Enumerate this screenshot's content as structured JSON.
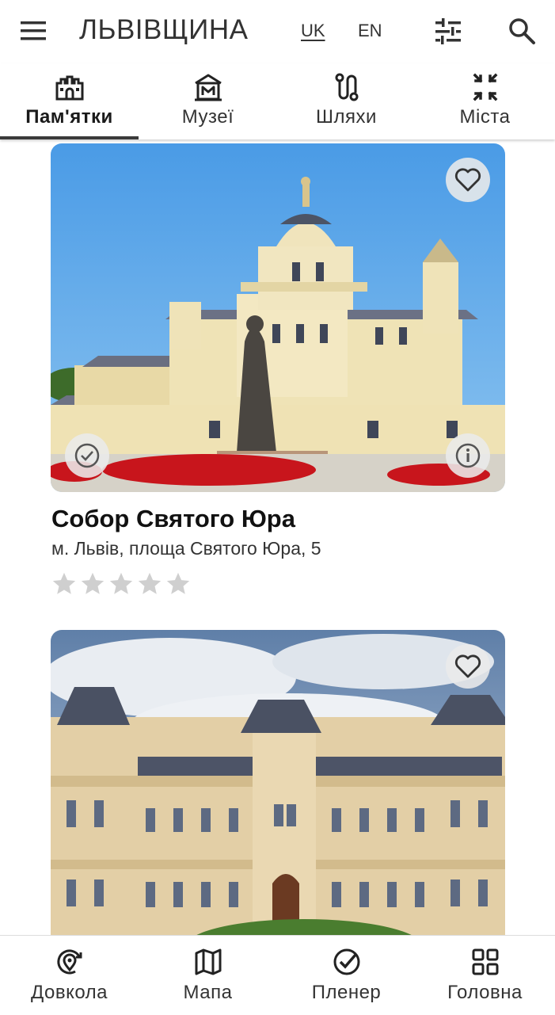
{
  "app": {
    "title": "ЛЬВІВЩИНА"
  },
  "lang": {
    "uk": "UK",
    "en": "EN"
  },
  "tabs": [
    {
      "label": "Пам'ятки",
      "icon": "castle-icon",
      "active": true
    },
    {
      "label": "Музеї",
      "icon": "museum-icon",
      "active": false
    },
    {
      "label": "Шляхи",
      "icon": "route-icon",
      "active": false
    },
    {
      "label": "Міста",
      "icon": "collapse-icon",
      "active": false
    }
  ],
  "cards": [
    {
      "title": "Собор Святого Юра",
      "address": "м. Львів, площа Святого Юра, 5",
      "rating": 0,
      "max_rating": 5
    },
    {
      "title": "",
      "address": ""
    }
  ],
  "bottom_nav": [
    {
      "label": "Довкола",
      "icon": "location-radar-icon"
    },
    {
      "label": "Мапа",
      "icon": "map-icon"
    },
    {
      "label": "Пленер",
      "icon": "check-circle-icon"
    },
    {
      "label": "Головна",
      "icon": "grid-icon"
    }
  ],
  "colors": {
    "accent": "#333333",
    "star": "#cfcfcf"
  }
}
